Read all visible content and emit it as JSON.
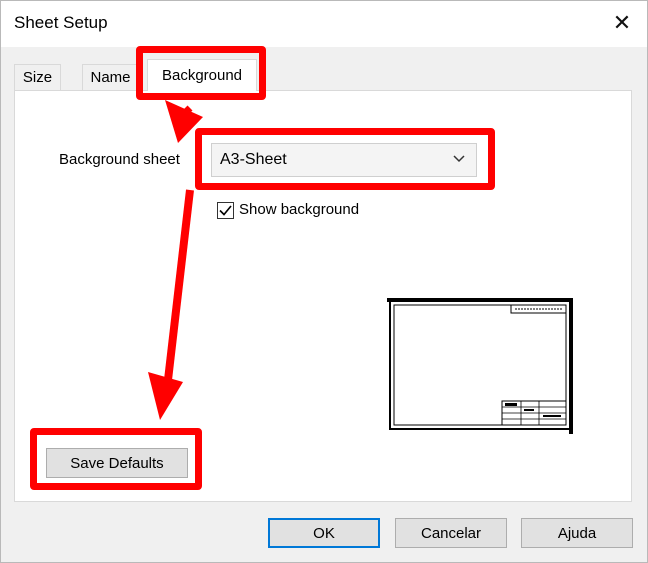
{
  "dialog": {
    "title": "Sheet Setup",
    "close_glyph": "✕"
  },
  "tabs": [
    {
      "label": "Size",
      "active": false
    },
    {
      "label": "Name",
      "active": false
    },
    {
      "label": "Background",
      "active": true
    }
  ],
  "background_tab": {
    "sheet_label": "Background sheet",
    "sheet_value": "A3-Sheet",
    "show_background_label": "Show background",
    "show_background_checked": true,
    "save_defaults_label": "Save Defaults"
  },
  "footer": {
    "ok_label": "OK",
    "cancel_label": "Cancelar",
    "help_label": "Ajuda"
  },
  "annotation": {
    "color": "#ff0000"
  },
  "icons": {
    "close": "close-icon",
    "dropdown": "chevron-down-icon",
    "check": "checkmark-icon",
    "preview": "sheet-preview-thumbnail"
  }
}
